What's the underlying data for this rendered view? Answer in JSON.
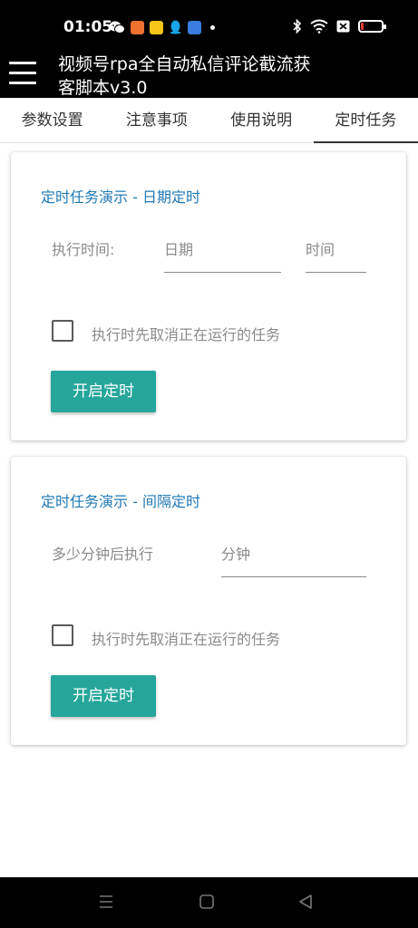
{
  "status": {
    "time": "01:05",
    "apps": [
      "wechat-icon",
      "game-icon",
      "news-icon",
      "qq-icon",
      "app-icon"
    ],
    "battery_level": 0.15
  },
  "app_bar": {
    "title": "视频号rpa全自动私信评论截流获客脚本v3.0"
  },
  "tabs": [
    {
      "label": "参数设置"
    },
    {
      "label": "注意事项"
    },
    {
      "label": "使用说明"
    },
    {
      "label": "定时任务"
    }
  ],
  "cards": [
    {
      "title": "定时任务演示 - 日期定时",
      "exec_label": "执行时间:",
      "date_placeholder": "日期",
      "time_placeholder": "时间",
      "checkbox_label": "执行时先取消正在运行的任务",
      "button_label": "开启定时"
    },
    {
      "title": "定时任务演示 - 间隔定时",
      "exec_label": "多少分钟后执行",
      "minutes_placeholder": "分钟",
      "checkbox_label": "执行时先取消正在运行的任务",
      "button_label": "开启定时"
    }
  ]
}
